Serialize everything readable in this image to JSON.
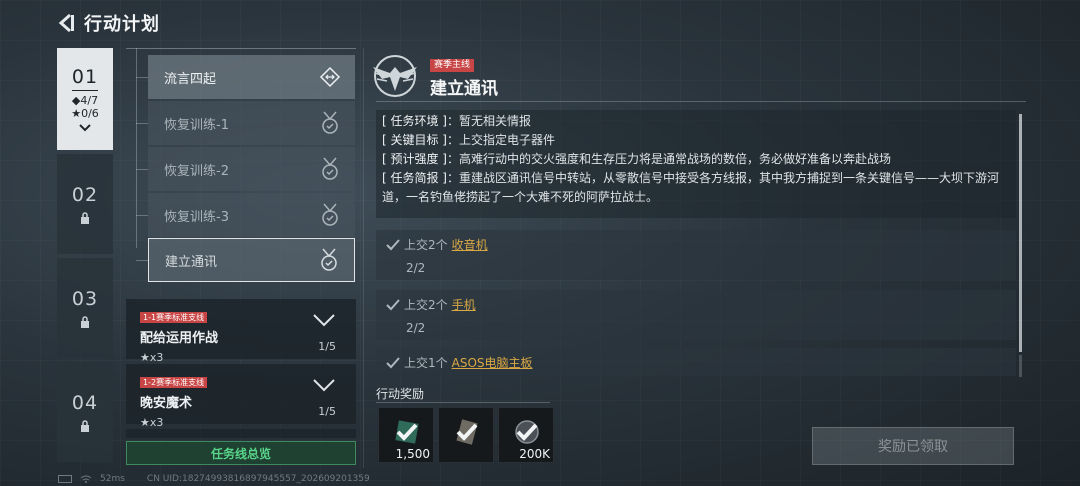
{
  "header": {
    "title": "行动计划"
  },
  "chapters": [
    {
      "num": "01",
      "diamonds": "◆4/7",
      "stars": "★0/6",
      "active": true
    },
    {
      "num": "02",
      "locked": true
    },
    {
      "num": "03",
      "locked": true
    },
    {
      "num": "04",
      "locked": true
    }
  ],
  "missions": {
    "sub_items": [
      {
        "label": "流言四起"
      },
      {
        "label": "恢复训练-1"
      },
      {
        "label": "恢复训练-2"
      },
      {
        "label": "恢复训练-3"
      },
      {
        "label": "建立通讯"
      }
    ],
    "branches": [
      {
        "tag": "1-1赛季标准支线",
        "title": "配给运用作战",
        "stars": "★x3",
        "progress": "1/5"
      },
      {
        "tag": "1-2赛季标准支线",
        "title": "晚安魔术",
        "stars": "★x3",
        "progress": "1/5"
      }
    ],
    "summary_button": "任务线总览"
  },
  "detail": {
    "season_tag": "赛季主线",
    "title": "建立通讯",
    "info": [
      {
        "key": "[ 任务环境 ]",
        "value": "：暂无相关情报"
      },
      {
        "key": "[ 关键目标 ]",
        "value": "：上交指定电子器件"
      },
      {
        "key": "[ 预计强度 ]",
        "value": "：高难行动中的交火强度和生存压力将是通常战场的数倍，务必做好准备以奔赴战场"
      },
      {
        "key": "[ 任务简报 ]",
        "value": "：重建战区通讯信号中转站，从零散信号中接受各方线报，其中我方捕捉到一条关键信号——大坝下游河道，一名钓鱼佬捞起了一个大难不死的阿萨拉战士。"
      }
    ],
    "objectives": [
      {
        "prefix": "上交2个",
        "item": "收音机",
        "progress": "2/2"
      },
      {
        "prefix": "上交2个",
        "item": "手机",
        "progress": "2/2"
      },
      {
        "prefix": "上交1个",
        "item": "ASOS电脑主板",
        "progress": ""
      }
    ],
    "reward_label": "行动奖励",
    "rewards": [
      {
        "qty": "1,500",
        "icon": "green-item-icon"
      },
      {
        "qty": "",
        "icon": "tablet-item-icon"
      },
      {
        "qty": "200K",
        "icon": "coin-icon"
      }
    ],
    "claim_button": "奖励已领取"
  },
  "footer": {
    "ping": "52ms",
    "uid": "CN UID:18274993816897945557_202609201359"
  },
  "colors": {
    "accent_red": "#c84545",
    "green": "#58d58a",
    "gold_link": "#d9a844"
  }
}
